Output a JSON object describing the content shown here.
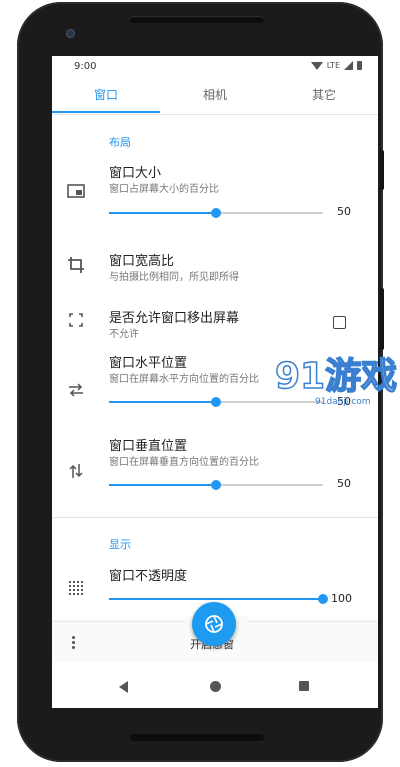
{
  "status": {
    "time": "9:00",
    "network": "LTE"
  },
  "tabs": [
    {
      "label": "窗口",
      "active": true
    },
    {
      "label": "相机",
      "active": false
    },
    {
      "label": "其它",
      "active": false
    }
  ],
  "sections": {
    "layout": "布局",
    "display": "显示"
  },
  "prefs": {
    "size": {
      "title": "窗口大小",
      "summary": "窗口占屏幕大小的百分比",
      "value": "50",
      "level": 0.5,
      "icon": "picture-in-picture-icon"
    },
    "aspect": {
      "title": "窗口宽高比",
      "summary": "与拍摄比例相同，所见即所得",
      "icon": "crop-icon"
    },
    "offscreen": {
      "title": "是否允许窗口移出屏幕",
      "summary": "不允许",
      "checked": false,
      "icon": "fullscreen-icon"
    },
    "hpos": {
      "title": "窗口水平位置",
      "summary": "窗口在屏幕水平方向位置的百分比",
      "value": "50",
      "level": 0.5,
      "icon": "swap-horizontal-icon"
    },
    "vpos": {
      "title": "窗口垂直位置",
      "summary": "窗口在屏幕垂直方向位置的百分比",
      "value": "50",
      "level": 0.5,
      "icon": "swap-vertical-icon"
    },
    "opacity": {
      "title": "窗口不透明度",
      "value": "100",
      "level": 1.0,
      "icon": "opacity-grid-icon"
    }
  },
  "bottombar": {
    "label": "开启悬窗",
    "fab_icon": "camera-aperture-icon"
  },
  "watermark": {
    "brand": "91游戏",
    "url": "91danji.com"
  },
  "colors": {
    "accent": "#2196f3",
    "fab": "#1e9bf0",
    "frame": "#1b1b1b"
  }
}
